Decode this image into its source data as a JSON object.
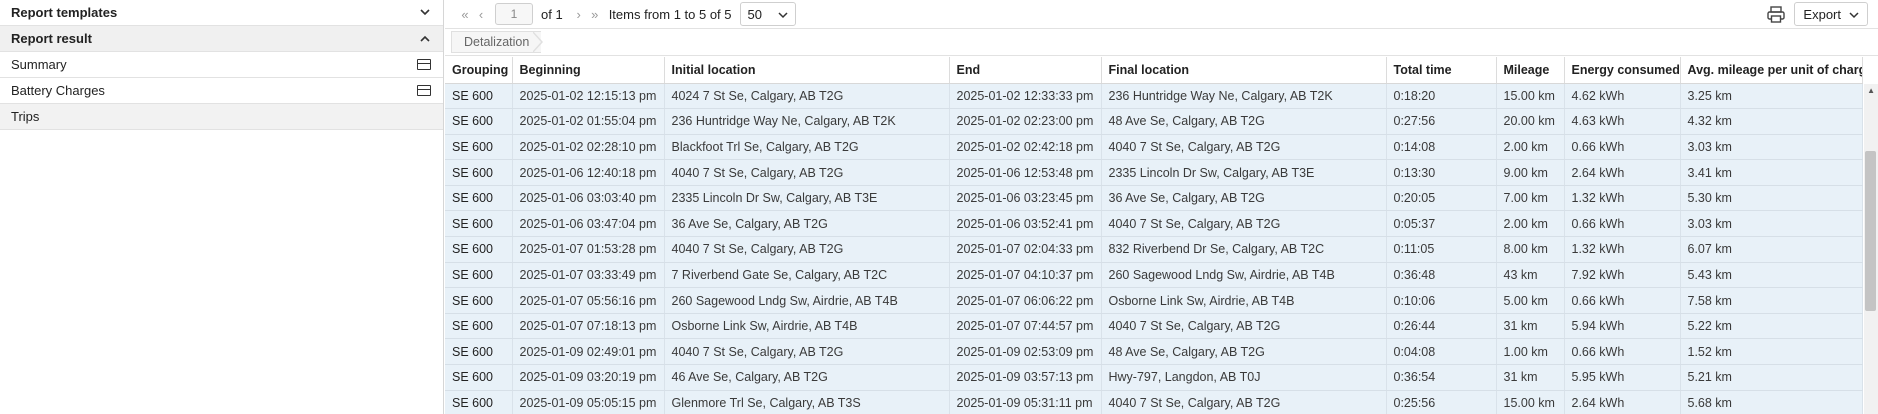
{
  "sidebar": {
    "report_templates": "Report templates",
    "report_result": "Report result",
    "items": [
      {
        "label": "Summary",
        "icon": "panel-icon"
      },
      {
        "label": "Battery Charges",
        "icon": "panel-icon"
      },
      {
        "label": "Trips",
        "icon": ""
      }
    ]
  },
  "toolbar": {
    "page_value": "1",
    "of_text": "of 1",
    "items_text": "Items from 1 to 5 of 5",
    "page_size": "50",
    "export_label": "Export"
  },
  "breadcrumb": {
    "label": "Detalization"
  },
  "table": {
    "columns": [
      "Grouping",
      "Beginning",
      "Initial location",
      "End",
      "Final location",
      "Total time",
      "Mileage",
      "Energy consumed",
      "Avg. mileage per unit of charge"
    ],
    "rows": [
      [
        "SE 600",
        "2025-01-02 12:15:13 pm",
        "4024 7 St Se, Calgary, AB T2G",
        "2025-01-02 12:33:33 pm",
        "236 Huntridge Way Ne, Calgary, AB T2K",
        "0:18:20",
        "15.00 km",
        "4.62 kWh",
        "3.25 km"
      ],
      [
        "SE 600",
        "2025-01-02 01:55:04 pm",
        "236 Huntridge Way Ne, Calgary, AB T2K",
        "2025-01-02 02:23:00 pm",
        "48 Ave Se, Calgary, AB T2G",
        "0:27:56",
        "20.00 km",
        "4.63 kWh",
        "4.32 km"
      ],
      [
        "SE 600",
        "2025-01-02 02:28:10 pm",
        "Blackfoot Trl Se, Calgary, AB T2G",
        "2025-01-02 02:42:18 pm",
        "4040 7 St Se, Calgary, AB T2G",
        "0:14:08",
        "2.00 km",
        "0.66 kWh",
        "3.03 km"
      ],
      [
        "SE 600",
        "2025-01-06 12:40:18 pm",
        "4040 7 St Se, Calgary, AB T2G",
        "2025-01-06 12:53:48 pm",
        "2335 Lincoln Dr Sw, Calgary, AB T3E",
        "0:13:30",
        "9.00 km",
        "2.64 kWh",
        "3.41 km"
      ],
      [
        "SE 600",
        "2025-01-06 03:03:40 pm",
        "2335 Lincoln Dr Sw, Calgary, AB T3E",
        "2025-01-06 03:23:45 pm",
        "36 Ave Se, Calgary, AB T2G",
        "0:20:05",
        "7.00 km",
        "1.32 kWh",
        "5.30 km"
      ],
      [
        "SE 600",
        "2025-01-06 03:47:04 pm",
        "36 Ave Se, Calgary, AB T2G",
        "2025-01-06 03:52:41 pm",
        "4040 7 St Se, Calgary, AB T2G",
        "0:05:37",
        "2.00 km",
        "0.66 kWh",
        "3.03 km"
      ],
      [
        "SE 600",
        "2025-01-07 01:53:28 pm",
        "4040 7 St Se, Calgary, AB T2G",
        "2025-01-07 02:04:33 pm",
        "832 Riverbend Dr Se, Calgary, AB T2C",
        "0:11:05",
        "8.00 km",
        "1.32 kWh",
        "6.07 km"
      ],
      [
        "SE 600",
        "2025-01-07 03:33:49 pm",
        "7 Riverbend Gate Se, Calgary, AB T2C",
        "2025-01-07 04:10:37 pm",
        "260 Sagewood Lndg Sw, Airdrie, AB T4B",
        "0:36:48",
        "43 km",
        "7.92 kWh",
        "5.43 km"
      ],
      [
        "SE 600",
        "2025-01-07 05:56:16 pm",
        "260 Sagewood Lndg Sw, Airdrie, AB T4B",
        "2025-01-07 06:06:22 pm",
        "Osborne Link Sw, Airdrie, AB T4B",
        "0:10:06",
        "5.00 km",
        "0.66 kWh",
        "7.58 km"
      ],
      [
        "SE 600",
        "2025-01-07 07:18:13 pm",
        "Osborne Link Sw, Airdrie, AB T4B",
        "2025-01-07 07:44:57 pm",
        "4040 7 St Se, Calgary, AB T2G",
        "0:26:44",
        "31 km",
        "5.94 kWh",
        "5.22 km"
      ],
      [
        "SE 600",
        "2025-01-09 02:49:01 pm",
        "4040 7 St Se, Calgary, AB T2G",
        "2025-01-09 02:53:09 pm",
        "48 Ave Se, Calgary, AB T2G",
        "0:04:08",
        "1.00 km",
        "0.66 kWh",
        "1.52 km"
      ],
      [
        "SE 600",
        "2025-01-09 03:20:19 pm",
        "46 Ave Se, Calgary, AB T2G",
        "2025-01-09 03:57:13 pm",
        "Hwy-797, Langdon, AB T0J",
        "0:36:54",
        "31 km",
        "5.95 kWh",
        "5.21 km"
      ],
      [
        "SE 600",
        "2025-01-09 05:05:15 pm",
        "Glenmore Trl Se, Calgary, AB T3S",
        "2025-01-09 05:31:11 pm",
        "4040 7 St Se, Calgary, AB T2G",
        "0:25:56",
        "15.00 km",
        "2.64 kWh",
        "5.68 km"
      ]
    ]
  }
}
